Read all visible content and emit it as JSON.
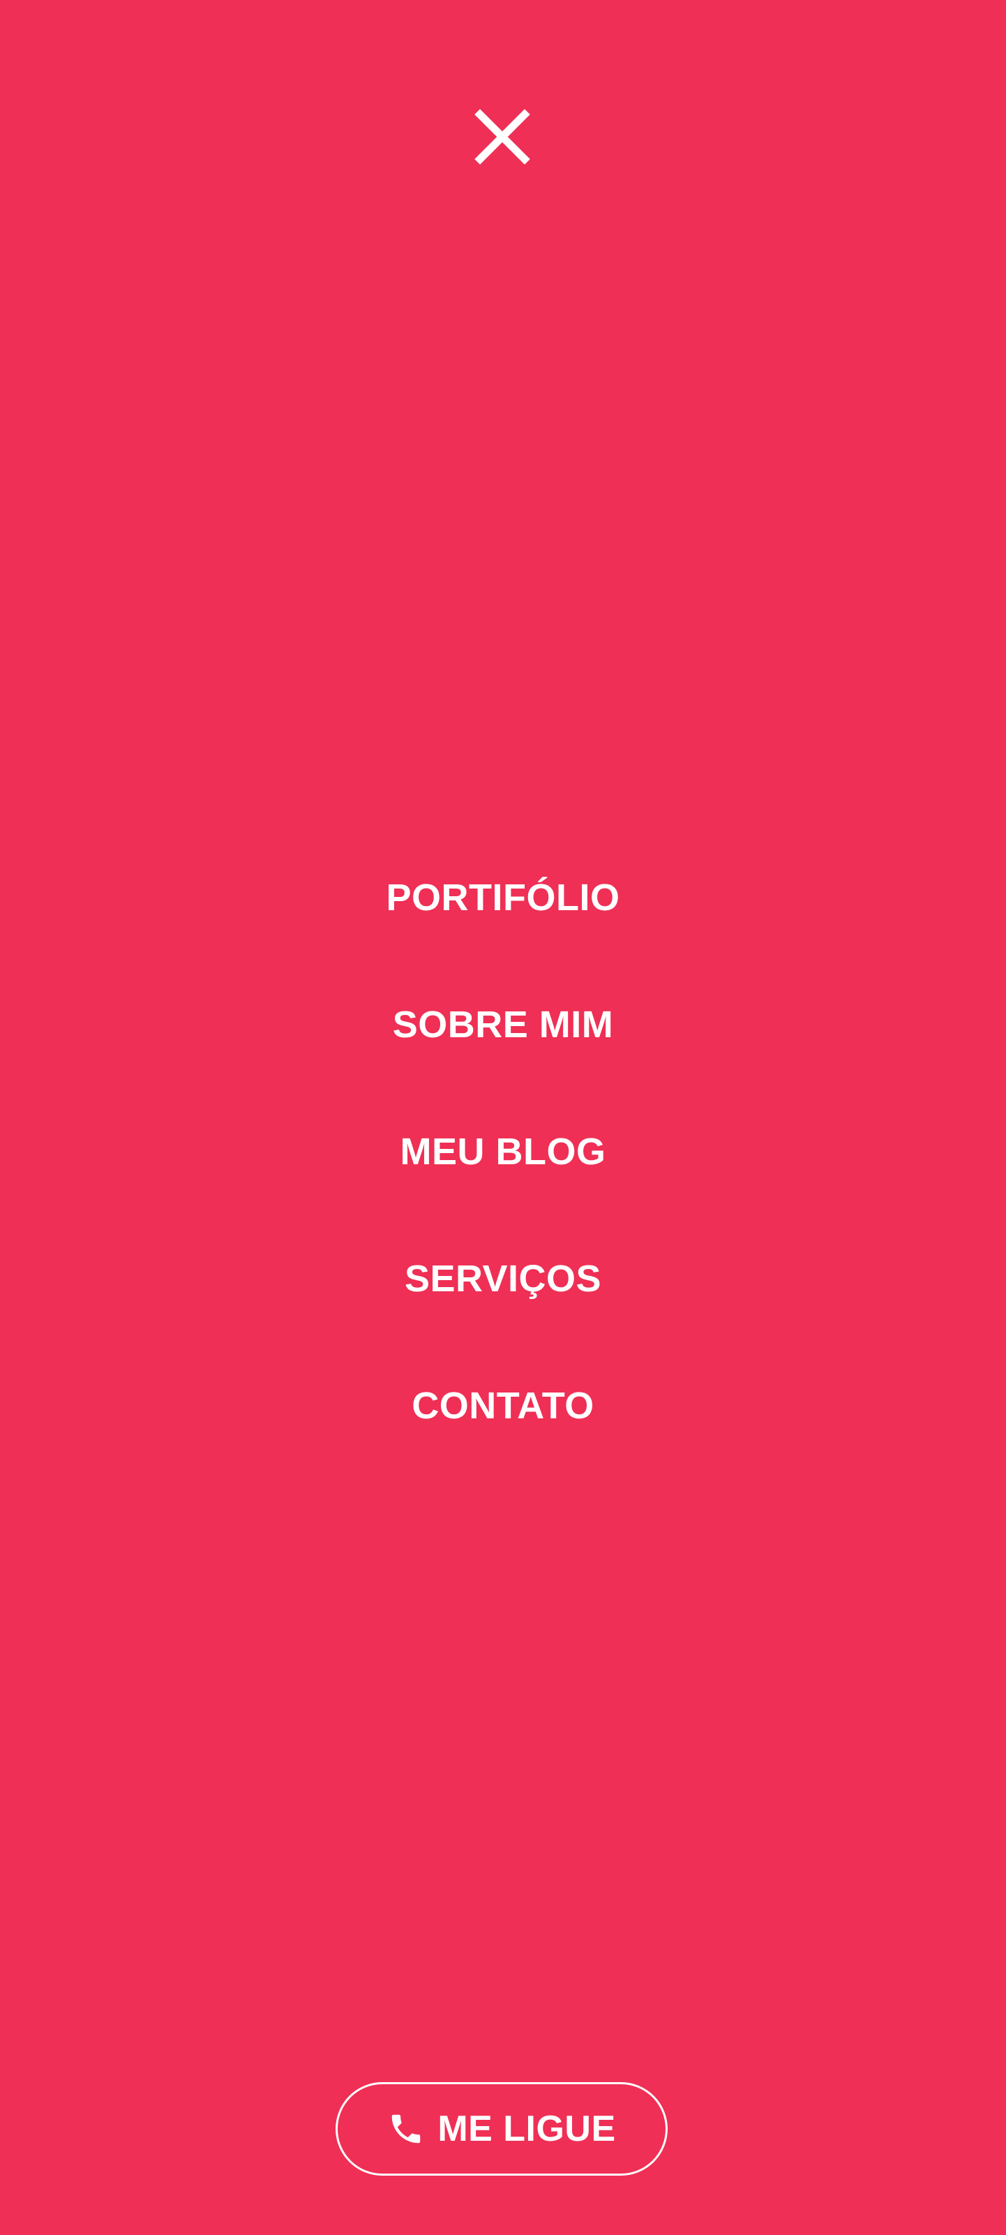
{
  "colors": {
    "background": "#EF2F55",
    "foreground": "#FFFFFF"
  },
  "close": {
    "icon": "close-icon"
  },
  "menu": {
    "items": [
      {
        "label": "PORTIFÓLIO"
      },
      {
        "label": "SOBRE MIM"
      },
      {
        "label": "MEU BLOG"
      },
      {
        "label": "SERVIÇOS"
      },
      {
        "label": "CONTATO"
      }
    ]
  },
  "cta": {
    "icon": "phone-icon",
    "label": "ME LIGUE"
  }
}
